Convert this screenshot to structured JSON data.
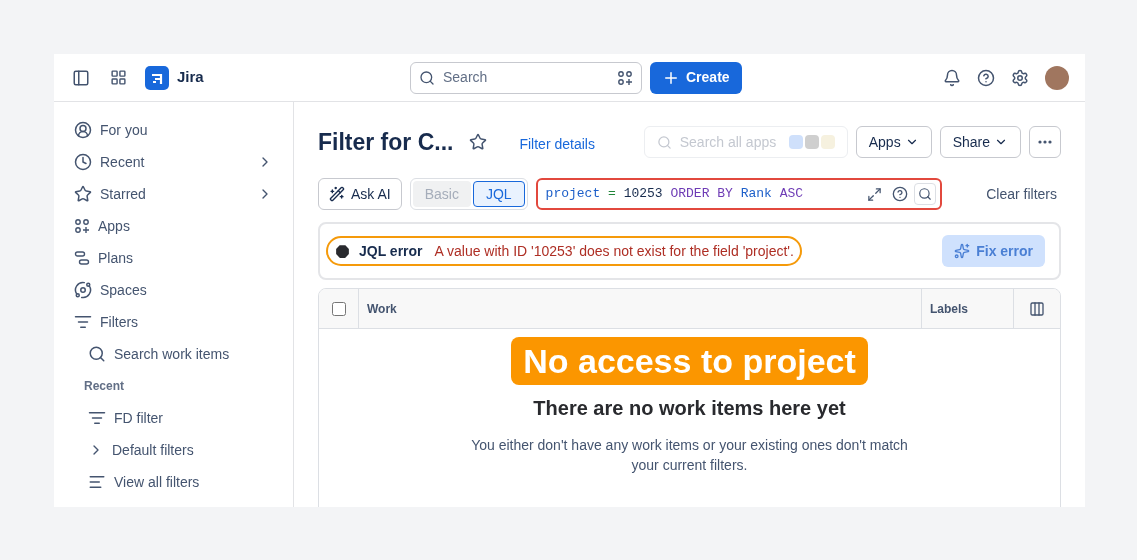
{
  "top_bar": {
    "product": "Jira",
    "search": {
      "placeholder": "Search"
    },
    "create_button": "Create"
  },
  "sidebar": {
    "items": [
      {
        "label": "For you",
        "chevron": false
      },
      {
        "label": "Recent",
        "chevron": true
      },
      {
        "label": "Starred",
        "chevron": true
      },
      {
        "label": "Apps",
        "chevron": false
      },
      {
        "label": "Plans",
        "chevron": false
      },
      {
        "label": "Spaces",
        "chevron": false
      },
      {
        "label": "Filters",
        "chevron": false,
        "children": [
          {
            "kind": "search",
            "label": "Search work items"
          },
          {
            "kind": "heading",
            "label": "Recent"
          },
          {
            "kind": "filter",
            "label": "FD filter"
          },
          {
            "kind": "folder",
            "label": "Default filters",
            "expanded": false
          },
          {
            "kind": "list",
            "label": "View all filters"
          }
        ]
      }
    ]
  },
  "header": {
    "title": "Filter for C...",
    "starred": false,
    "details_link": "Filter details",
    "apps_search": {
      "placeholder": "Search all apps"
    },
    "apps_button": "Apps",
    "share_button": "Share"
  },
  "query_bar": {
    "ask_ai": "Ask AI",
    "modes": [
      {
        "label": "Basic",
        "selected": false
      },
      {
        "label": "JQL",
        "selected": true
      }
    ],
    "tokens": [
      {
        "kind": "field",
        "text": "project"
      },
      {
        "kind": "operator",
        "text": "="
      },
      {
        "kind": "value",
        "text": "10253"
      },
      {
        "kind": "keyword",
        "text": "ORDER BY"
      },
      {
        "kind": "field",
        "text": "Rank"
      },
      {
        "kind": "keyword",
        "text": "ASC"
      }
    ],
    "invalid": true,
    "clear_filters": "Clear filters"
  },
  "error": {
    "title": "JQL error",
    "message": "A value with ID '10253' does not exist for the field 'project'.",
    "fix_button": "Fix error",
    "fix_disabled": true
  },
  "table": {
    "columns": [
      "Work",
      "Labels"
    ],
    "select_all_checked": false
  },
  "annotation": "No access to project",
  "empty_state": {
    "title": "There are no work items here yet",
    "message": "You either don't have any work items or your existing ones don't match your current filters."
  }
}
